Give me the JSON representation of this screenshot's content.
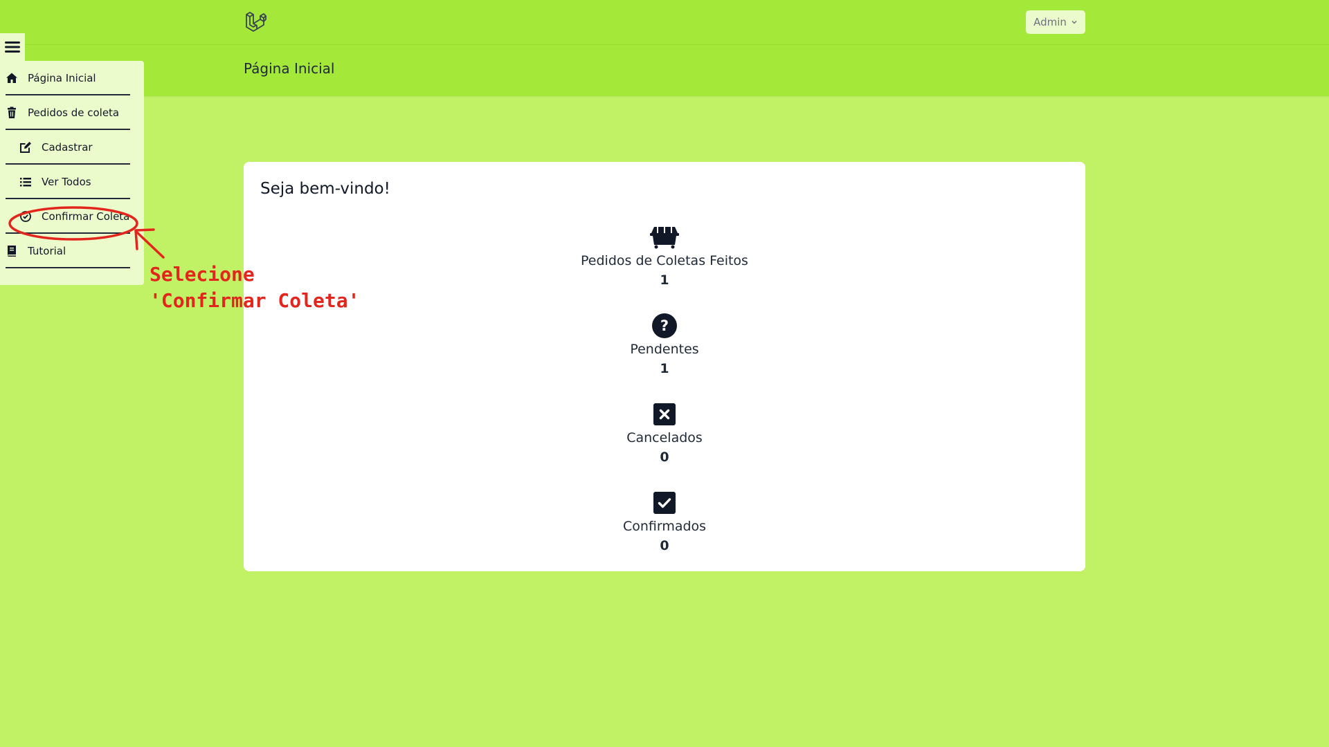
{
  "topbar": {
    "logo_icon": "laravel-logo-icon",
    "user_menu_label": "Admin",
    "user_menu_icon": "chevron-down-icon"
  },
  "header": {
    "title": "Página Inicial"
  },
  "sidebar": {
    "toggle_icon": "hamburger-menu-icon",
    "items": [
      {
        "label": "Página Inicial",
        "icon": "home-icon"
      },
      {
        "label": "Pedidos de coleta",
        "icon": "trash-icon"
      },
      {
        "label": "Cadastrar",
        "icon": "edit-icon"
      },
      {
        "label": "Ver Todos",
        "icon": "list-icon"
      },
      {
        "label": "Confirmar Coleta",
        "icon": "check-circle-icon"
      },
      {
        "label": "Tutorial",
        "icon": "book-icon"
      }
    ]
  },
  "main": {
    "welcome": "Seja bem-vindo!",
    "stats": [
      {
        "label": "Pedidos de Coletas Feitos",
        "value": "1",
        "icon": "dumpster-icon"
      },
      {
        "label": "Pendentes",
        "value": "1",
        "icon": "question-circle-icon"
      },
      {
        "label": "Cancelados",
        "value": "0",
        "icon": "x-square-icon"
      },
      {
        "label": "Confirmados",
        "value": "0",
        "icon": "check-square-icon"
      }
    ]
  },
  "annotation": {
    "text": "Selecione\n'Confirmar Coleta'",
    "color": "#e3261d"
  },
  "colors": {
    "background": "#c1f164",
    "topbar": "#a4e839",
    "sidebar": "#ecfbcc",
    "card": "#ffffff",
    "icon_dark": "#111827"
  }
}
